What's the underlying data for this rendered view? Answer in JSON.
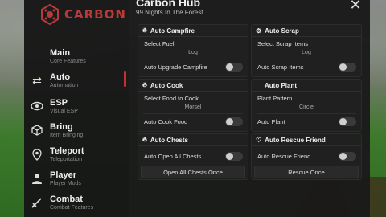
{
  "app": {
    "logo_text": "CARBON",
    "title": "Carbon Hub",
    "subtitle": "99 Nights In The Forest"
  },
  "sidebar": {
    "items": [
      {
        "title": "Main",
        "sub": "Core Features",
        "icon": "home-icon"
      },
      {
        "title": "Auto",
        "sub": "Automation",
        "icon": "arrows-icon",
        "active": true
      },
      {
        "title": "ESP",
        "sub": "Visual ESP",
        "icon": "eye-icon"
      },
      {
        "title": "Bring",
        "sub": "Item Bringing",
        "icon": "cube-icon"
      },
      {
        "title": "Teleport",
        "sub": "Teleportation",
        "icon": "location-pin-icon"
      },
      {
        "title": "Player",
        "sub": "Player Mods",
        "icon": "person-icon"
      },
      {
        "title": "Combat",
        "sub": "Combat Features",
        "icon": "sword-icon"
      }
    ]
  },
  "panels": {
    "campfire": {
      "title": "Auto Campfire",
      "field_label": "Select Fuel",
      "field_value": "Log",
      "toggle_label": "Auto Upgrade Campfire",
      "toggle_on": false
    },
    "scrap": {
      "title": "Auto Scrap",
      "field_label": "Select Scrap Items",
      "field_value": "Log",
      "toggle_label": "Auto Scrap Items",
      "toggle_on": false
    },
    "cook": {
      "title": "Auto Cook",
      "field_label": "Select Food to Cook",
      "field_value": "Morsel",
      "toggle_label": "Auto Cook Food",
      "toggle_on": false
    },
    "plant": {
      "title": "Auto Plant",
      "field_label": "Plant Pattern",
      "field_value": "Circle",
      "toggle_label": "Auto Plant",
      "toggle_on": false
    },
    "chests": {
      "title": "Auto Chests",
      "toggle_label": "Auto Open All Chests",
      "toggle_on": false,
      "button_label": "Open All Chests Once"
    },
    "rescue": {
      "title": "Auto Rescue Friend",
      "toggle_label": "Auto Rescue Friend",
      "toggle_on": false,
      "button_label": "Rescue Once"
    }
  },
  "colors": {
    "accent": "#c23030",
    "panel_bg": "#202020",
    "sidebar_bg": "#161616"
  }
}
